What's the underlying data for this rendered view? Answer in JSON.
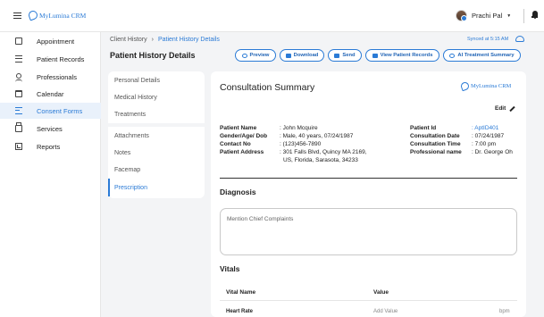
{
  "app": {
    "logo_text": "MyLumina CRM"
  },
  "user": {
    "name": "Prachi Pal"
  },
  "sidebar": {
    "items": [
      {
        "label": "Appointment",
        "icon": "appointment-icon"
      },
      {
        "label": "Patient Records",
        "icon": "records-icon"
      },
      {
        "label": "Professionals",
        "icon": "person-icon"
      },
      {
        "label": "Calendar",
        "icon": "calendar-icon"
      },
      {
        "label": "Consent Forms",
        "icon": "consent-icon",
        "active": true
      },
      {
        "label": "Services",
        "icon": "bag-icon"
      },
      {
        "label": "Reports",
        "icon": "report-icon"
      }
    ]
  },
  "header": {
    "breadcrumb": [
      "Client History",
      "Patient History Details"
    ],
    "sync_status": "Synced at 5:15 AM",
    "title": "Patient History Details",
    "buttons": {
      "preview": "Preview",
      "download": "Download",
      "send": "Send",
      "view_records": "View Patient Records",
      "ai_summary": "AI Treatment Summary"
    }
  },
  "tabs": [
    {
      "label": "Personal Details"
    },
    {
      "label": "Medical History"
    },
    {
      "label": "Treatments"
    },
    {
      "label": "Attachments"
    },
    {
      "label": "Notes"
    },
    {
      "label": "Facemap"
    },
    {
      "label": "Prescription",
      "active": true
    }
  ],
  "consultation": {
    "title": "Consultation Summary",
    "edit_label": "Edit",
    "patient_name_label": "Patient Name",
    "patient_name": ": John Mcquire",
    "gender_label": "Gender/Age/ Dob",
    "gender": ": Male, 40 years, 07/24/1987",
    "contact_label": "Contact No",
    "contact": ": (123)456-7890",
    "address_label": "Patient Address",
    "address_line1": ": 301 Falls Blvd, Quincy MA  2169,",
    "address_line2": "US, Florida, Sarasota, 34233",
    "patient_id_label": "Patient Id",
    "patient_id": ": AptID401",
    "date_label": "Consultation Date",
    "date": ": 07/24/1987",
    "time_label": "Consultation Time",
    "time": ": 7:00 pm",
    "professional_label": "Professional name",
    "professional": ": Dr. George Oh"
  },
  "diagnosis": {
    "title": "Diagnosis",
    "placeholder": "Mention Chief Complaints"
  },
  "vitals": {
    "title": "Vitals",
    "col_name": "Vital Name",
    "col_value": "Value",
    "rows": [
      {
        "name": "Heart Rate",
        "placeholder": "Add Value",
        "unit": "bpm"
      }
    ]
  },
  "colors": {
    "accent": "#2b7bd6",
    "active_bg": "#e9f1fb"
  }
}
